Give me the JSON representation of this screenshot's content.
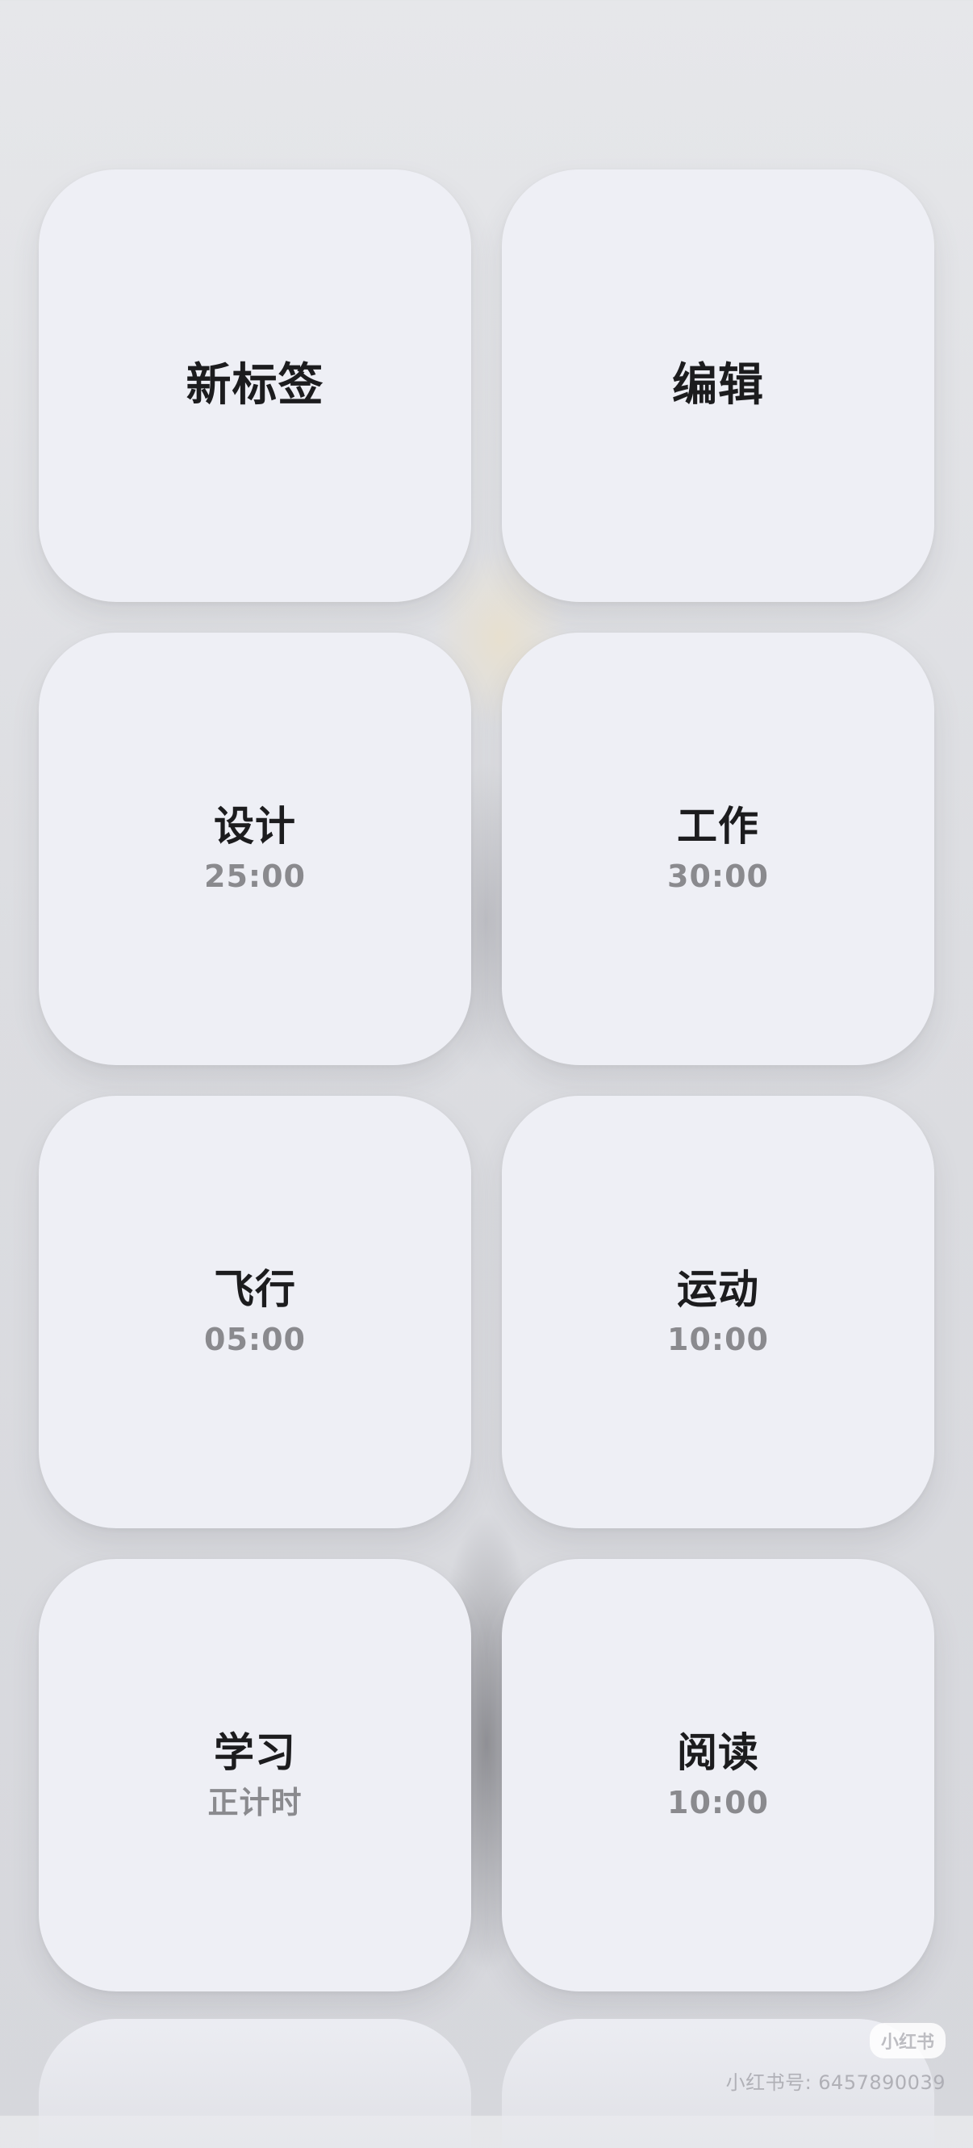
{
  "tiles": [
    {
      "title": "新标签",
      "subtitle": ""
    },
    {
      "title": "编辑",
      "subtitle": ""
    },
    {
      "title": "设计",
      "subtitle": "25:00"
    },
    {
      "title": "工作",
      "subtitle": "30:00"
    },
    {
      "title": "飞行",
      "subtitle": "05:00"
    },
    {
      "title": "运动",
      "subtitle": "10:00"
    },
    {
      "title": "学习",
      "subtitle": "正计时"
    },
    {
      "title": "阅读",
      "subtitle": "10:00"
    }
  ],
  "watermark": {
    "logo": "小红书",
    "id_text": "小红书号: 6457890039"
  }
}
